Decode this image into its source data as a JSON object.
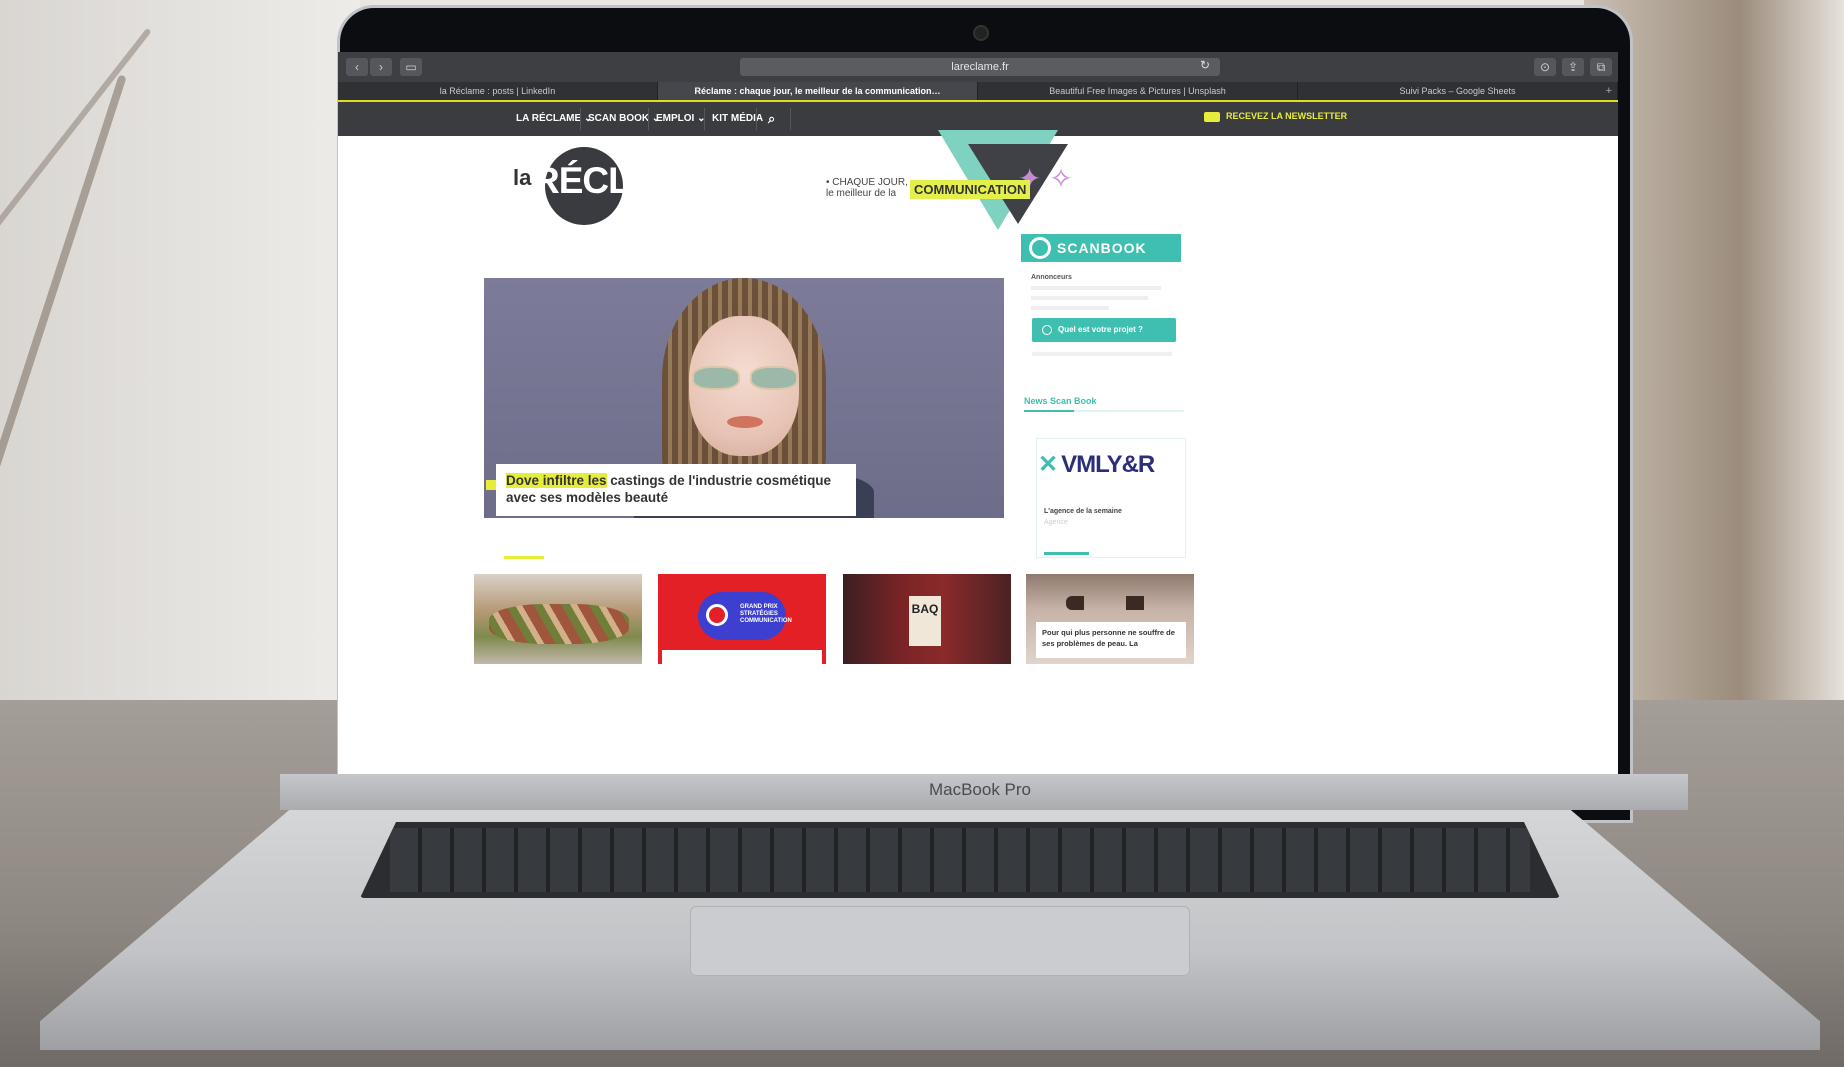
{
  "device": {
    "model_label": "MacBook Pro"
  },
  "browser": {
    "url": "lareclame.fr",
    "tabs": [
      {
        "label": "la Réclame : posts | LinkedIn",
        "active": false
      },
      {
        "label": "Réclame : chaque jour, le meilleur de la communication…",
        "active": true
      },
      {
        "label": "Beautiful Free Images & Pictures | Unsplash",
        "active": false
      },
      {
        "label": "Suivi Packs – Google Sheets",
        "active": false
      }
    ]
  },
  "site_nav": {
    "items": [
      "LA RÉCLAME ⌄",
      "SCAN BOOK ⌄",
      "EMPLOI ⌄",
      "KIT MÉDIA"
    ],
    "newsletter": "RECEVEZ LA NEWSLETTER"
  },
  "header": {
    "logo_prefix": "la",
    "logo_word": "RÉCLAME",
    "tagline_line1": "• CHAQUE JOUR,",
    "tagline_line2": "le meilleur de la",
    "tagline_highlight": "COMMUNICATION"
  },
  "hero": {
    "title_highlight": "Dove infiltre les",
    "title_rest": " castings de l'industrie cosmétique avec ses modèles beauté"
  },
  "sidebar": {
    "scanbook_logo": "SCANBOOK",
    "annonceurs_label": "Annonceurs",
    "project_button": "Quel est votre projet ?",
    "news_heading": "News Scan Book",
    "agency_name": "VMLY&R",
    "agency_caption": "L'agence de la semaine",
    "agency_sub": "Agence"
  },
  "thumbs": [
    {
      "caption": ""
    },
    {
      "logo_text": "GRAND PRIX STRATÉGIES COMMUNICATION",
      "caption": ""
    },
    {
      "sign_text": "BAQ"
    },
    {
      "caption": "Pour qui plus personne ne souffre de ses problèmes de peau. La"
    }
  ],
  "colors": {
    "accent_yellow": "#e6ec3a",
    "scanbook_teal": "#3fbfb0",
    "nav_dark": "#3a3c40"
  }
}
